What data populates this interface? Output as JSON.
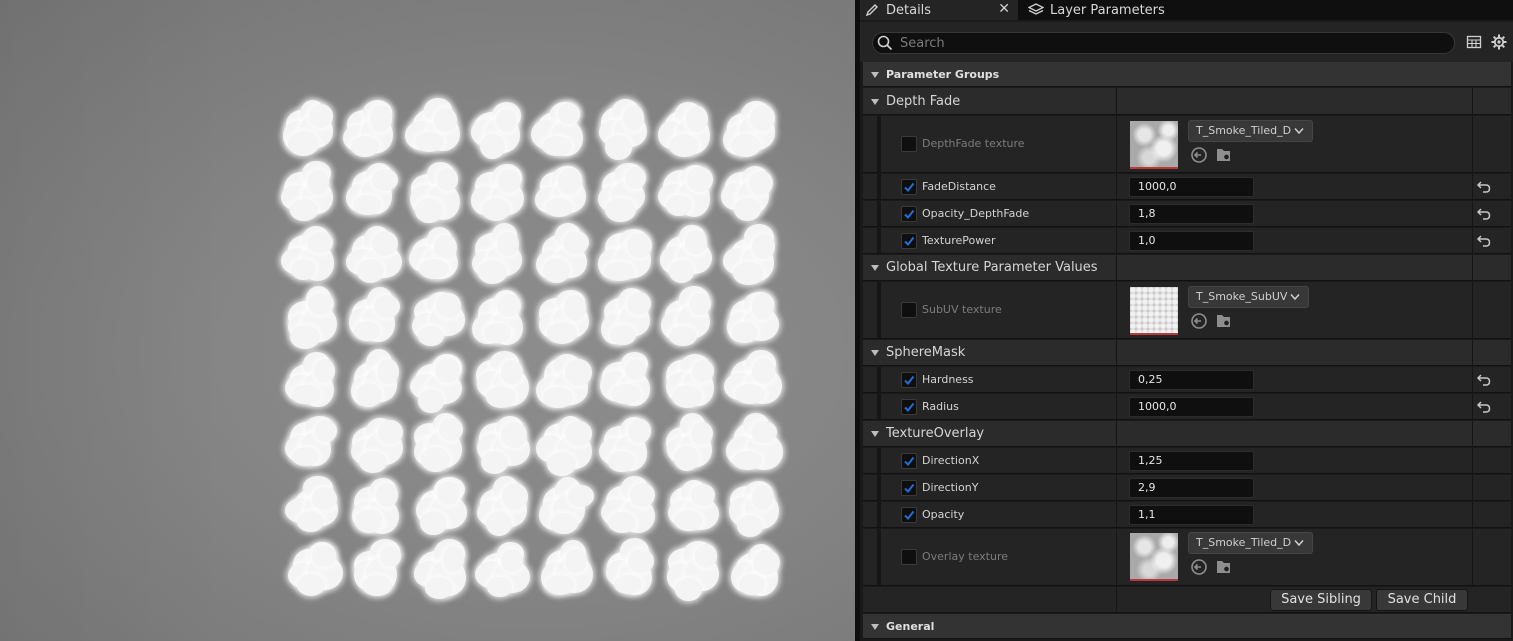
{
  "tabs": {
    "details": {
      "label": "Details",
      "icon": "pencil-icon"
    },
    "layer_parameters": {
      "label": "Layer Parameters",
      "icon": "layers-icon"
    }
  },
  "search": {
    "placeholder": "Search",
    "value": ""
  },
  "groups": {
    "parameter_groups": "Parameter Groups",
    "depth_fade": "Depth Fade",
    "global_texture": "Global Texture Parameter Values",
    "sphere_mask": "SphereMask",
    "texture_overlay": "TextureOverlay",
    "general": "General"
  },
  "params": {
    "depthfade_texture": {
      "label": "DepthFade texture",
      "enabled": false,
      "texture": "T_Smoke_Tiled_D"
    },
    "fade_distance": {
      "label": "FadeDistance",
      "enabled": true,
      "value": "1000,0"
    },
    "opacity_depthfade": {
      "label": "Opacity_DepthFade",
      "enabled": true,
      "value": "1,8"
    },
    "texture_power": {
      "label": "TexturePower",
      "enabled": true,
      "value": "1,0"
    },
    "subuv_texture": {
      "label": "SubUV texture",
      "enabled": false,
      "texture": "T_Smoke_SubUV"
    },
    "hardness": {
      "label": "Hardness",
      "enabled": true,
      "value": "0,25"
    },
    "radius": {
      "label": "Radius",
      "enabled": true,
      "value": "1000,0"
    },
    "direction_x": {
      "label": "DirectionX",
      "enabled": true,
      "value": "1,25"
    },
    "direction_y": {
      "label": "DirectionY",
      "enabled": true,
      "value": "2,9"
    },
    "opacity": {
      "label": "Opacity",
      "enabled": true,
      "value": "1,1"
    },
    "overlay_texture": {
      "label": "Overlay texture",
      "enabled": false,
      "texture": "T_Smoke_Tiled_D"
    }
  },
  "buttons": {
    "save_sibling": "Save Sibling",
    "save_child": "Save Child"
  },
  "viewport": {
    "subuv_grid": "8x8"
  },
  "colors": {
    "accent_check": "#1f6fd6",
    "reset_icon": "#c8c8c8",
    "texture_underline": "#b83a3a"
  }
}
